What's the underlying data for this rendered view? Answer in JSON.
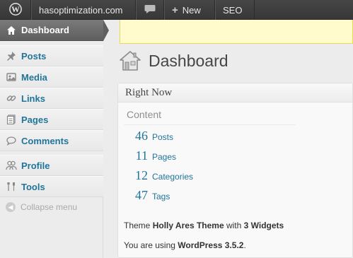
{
  "adminbar": {
    "wp_logo_icon": "wordpress-logo-icon",
    "site_name": "hasoptimization.com",
    "comments_icon": "speech-bubble-icon",
    "new_label": "New",
    "seo_label": "SEO"
  },
  "sidebar": {
    "items": [
      {
        "label": "Dashboard",
        "icon": "home-icon"
      },
      {
        "label": "Posts",
        "icon": "pushpin-icon"
      },
      {
        "label": "Media",
        "icon": "media-icon"
      },
      {
        "label": "Links",
        "icon": "link-icon"
      },
      {
        "label": "Pages",
        "icon": "pages-icon"
      },
      {
        "label": "Comments",
        "icon": "comment-icon"
      },
      {
        "label": "Profile",
        "icon": "users-icon"
      },
      {
        "label": "Tools",
        "icon": "tools-icon"
      }
    ],
    "collapse_label": "Collapse menu"
  },
  "main": {
    "title": "Dashboard",
    "widget": {
      "title": "Right Now",
      "section": "Content",
      "stats": [
        {
          "num": "46",
          "label": "Posts"
        },
        {
          "num": "11",
          "label": "Pages"
        },
        {
          "num": "12",
          "label": "Categories"
        },
        {
          "num": "47",
          "label": "Tags"
        }
      ],
      "theme_prefix": "Theme",
      "theme_name": "Holly Ares Theme",
      "theme_middle": "with",
      "theme_widgets": "3 Widgets",
      "version_prefix": "You are using",
      "version": "WordPress 3.5.2",
      "version_suffix": "."
    }
  },
  "colors": {
    "link": "#21759b",
    "adminbar": "#464646",
    "notice": "#fffbcc"
  }
}
